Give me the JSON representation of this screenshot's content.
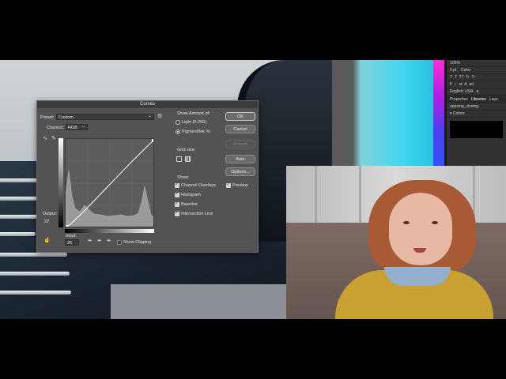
{
  "curves_dialog": {
    "title": "Curves",
    "preset_label": "Preset:",
    "preset_value": "Custom",
    "channel_label": "Channel:",
    "channel_value": "RGB",
    "output_label": "Output:",
    "output_value": "22",
    "input_label": "Input:",
    "input_value": "26",
    "show_clipping_label": "Show Clipping",
    "show_amount_label": "Show Amount of:",
    "light_option": "Light  (0-255)",
    "pigment_option": "Pigment/Ink %",
    "grid_size_label": "Grid size:",
    "show_label": "Show:",
    "channel_overlays_label": "Channel Overlays",
    "histogram_label": "Histogram",
    "baseline_label": "Baseline",
    "intersection_line_label": "Intersection Line",
    "ok_label": "OK",
    "cancel_label": "Cancel",
    "smooth_label": "Smooth",
    "auto_label": "Auto",
    "options_label": "Options...",
    "preview_label": "Preview"
  },
  "ps_panel": {
    "zoom_value": "100%",
    "pt_value": "0 pt",
    "color_label": "Color:",
    "language_value": "English: USA",
    "aa_value": "a",
    "tab_properties": "Properties",
    "tab_libraries": "Libraries",
    "tab_layers": "Laye",
    "library_select": "opening_closing",
    "colors_label": "Colors"
  },
  "icons": {
    "gear": "gear-icon",
    "curve_point": "curve-point-tool-icon",
    "pencil": "pencil-icon",
    "eyedropper": "eyedropper-icon",
    "hand": "targeted-adjustment-icon"
  }
}
